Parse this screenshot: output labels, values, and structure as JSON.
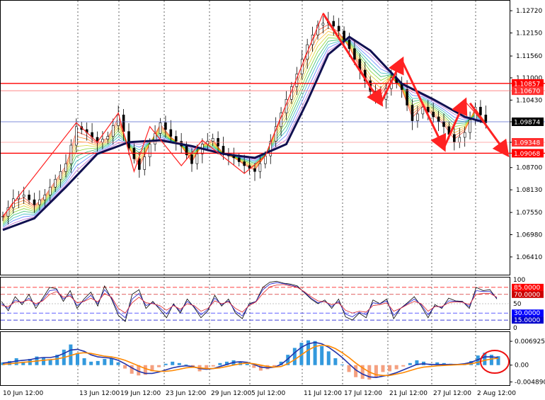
{
  "chart_data": [
    {
      "type": "candlestick",
      "panel": "price",
      "title": "",
      "ylim": [
        1.061,
        1.1285
      ],
      "y_ticks": [
        "1.12720",
        "1.12150",
        "1.11560",
        "1.11000",
        "1.10430",
        "1.09874",
        "1.09348",
        "1.08700",
        "1.08130",
        "1.07550",
        "1.06980",
        "1.06410"
      ],
      "x_ticks": [
        "10 Jun 12:00",
        "13 Jun 12:00",
        "19 Jun 12:00",
        "23 Jun 12:00",
        "29 Jun 12:00",
        "5 Jul 12:00",
        "11 Jul 12:00",
        "17 Jul 12:00",
        "21 Jul 12:00",
        "27 Jul 12:00",
        "2 Aug 12:00"
      ],
      "close_path": [
        {
          "i": 0,
          "v": 1.0745
        },
        {
          "i": 2,
          "v": 1.079
        },
        {
          "i": 4,
          "v": 1.08
        },
        {
          "i": 6,
          "v": 1.0775
        },
        {
          "i": 8,
          "v": 1.08
        },
        {
          "i": 10,
          "v": 1.084
        },
        {
          "i": 12,
          "v": 1.088
        },
        {
          "i": 14,
          "v": 1.0975
        },
        {
          "i": 16,
          "v": 1.096
        },
        {
          "i": 18,
          "v": 1.0935
        },
        {
          "i": 20,
          "v": 1.095
        },
        {
          "i": 22,
          "v": 1.1005
        },
        {
          "i": 24,
          "v": 1.092
        },
        {
          "i": 26,
          "v": 1.0865
        },
        {
          "i": 28,
          "v": 1.093
        },
        {
          "i": 30,
          "v": 1.0985
        },
        {
          "i": 32,
          "v": 1.095
        },
        {
          "i": 34,
          "v": 1.0925
        },
        {
          "i": 36,
          "v": 1.088
        },
        {
          "i": 38,
          "v": 1.093
        },
        {
          "i": 40,
          "v": 1.0945
        },
        {
          "i": 42,
          "v": 1.0905
        },
        {
          "i": 44,
          "v": 1.0895
        },
        {
          "i": 46,
          "v": 1.0875
        },
        {
          "i": 48,
          "v": 1.086
        },
        {
          "i": 50,
          "v": 1.09
        },
        {
          "i": 52,
          "v": 1.0975
        },
        {
          "i": 54,
          "v": 1.1045
        },
        {
          "i": 56,
          "v": 1.111
        },
        {
          "i": 58,
          "v": 1.1185
        },
        {
          "i": 60,
          "v": 1.1235
        },
        {
          "i": 62,
          "v": 1.1245
        },
        {
          "i": 64,
          "v": 1.122
        },
        {
          "i": 66,
          "v": 1.1175
        },
        {
          "i": 68,
          "v": 1.112
        },
        {
          "i": 70,
          "v": 1.1065
        },
        {
          "i": 72,
          "v": 1.1045
        },
        {
          "i": 74,
          "v": 1.11
        },
        {
          "i": 76,
          "v": 1.107
        },
        {
          "i": 78,
          "v": 1.099
        },
        {
          "i": 80,
          "v": 1.1025
        },
        {
          "i": 82,
          "v": 1.1
        },
        {
          "i": 84,
          "v": 1.0975
        },
        {
          "i": 86,
          "v": 1.0935
        },
        {
          "i": 88,
          "v": 1.096
        },
        {
          "i": 90,
          "v": 1.1025
        },
        {
          "i": 92,
          "v": 1.0985
        }
      ],
      "moving_average": [
        {
          "i": 0,
          "v": 1.071
        },
        {
          "i": 6,
          "v": 1.074
        },
        {
          "i": 12,
          "v": 1.082
        },
        {
          "i": 18,
          "v": 1.0905
        },
        {
          "i": 24,
          "v": 1.0935
        },
        {
          "i": 30,
          "v": 1.094
        },
        {
          "i": 36,
          "v": 1.0925
        },
        {
          "i": 42,
          "v": 1.0905
        },
        {
          "i": 48,
          "v": 1.0895
        },
        {
          "i": 54,
          "v": 1.093
        },
        {
          "i": 58,
          "v": 1.104
        },
        {
          "i": 62,
          "v": 1.116
        },
        {
          "i": 66,
          "v": 1.1205
        },
        {
          "i": 70,
          "v": 1.117
        },
        {
          "i": 76,
          "v": 1.1085
        },
        {
          "i": 82,
          "v": 1.1045
        },
        {
          "i": 88,
          "v": 1.1
        },
        {
          "i": 92,
          "v": 1.0985
        }
      ],
      "zigzag": [
        {
          "i": 0,
          "v": 1.0745
        },
        {
          "i": 14,
          "v": 1.0985
        },
        {
          "i": 18,
          "v": 1.0935
        },
        {
          "i": 22,
          "v": 1.101
        },
        {
          "i": 25,
          "v": 1.086
        },
        {
          "i": 28,
          "v": 1.0975
        },
        {
          "i": 34,
          "v": 1.0875
        },
        {
          "i": 38,
          "v": 1.094
        },
        {
          "i": 46,
          "v": 1.0855
        },
        {
          "i": 50,
          "v": 1.09
        },
        {
          "i": 61,
          "v": 1.1265
        },
        {
          "i": 72,
          "v": 1.1035
        },
        {
          "i": 76,
          "v": 1.1145
        },
        {
          "i": 84,
          "v": 1.092
        },
        {
          "i": 88,
          "v": 1.104
        },
        {
          "i": 92,
          "v": 1.098
        }
      ],
      "arrows": [
        {
          "from": {
            "i": 61,
            "v": 1.1265
          },
          "to": {
            "i": 72,
            "v": 1.1035
          }
        },
        {
          "from": {
            "i": 72,
            "v": 1.1035
          },
          "to": {
            "i": 76,
            "v": 1.1145
          }
        },
        {
          "from": {
            "i": 76,
            "v": 1.1145
          },
          "to": {
            "i": 84,
            "v": 1.092
          }
        },
        {
          "from": {
            "i": 84,
            "v": 1.092
          },
          "to": {
            "i": 88,
            "v": 1.104
          }
        },
        {
          "from": {
            "i": 89,
            "v": 1.1035
          },
          "to": {
            "i": 96,
            "v": 1.0905
          }
        }
      ],
      "levels": [
        {
          "label": "1.10857",
          "value": 1.10857,
          "color": "#ff0000",
          "tag_color": "#ff0000",
          "width": 1.4
        },
        {
          "label": "1.10670",
          "value": 1.1067,
          "color": "#ff6060",
          "tag_color": "#ff3030",
          "width": 0.8
        },
        {
          "label": "1.09874",
          "value": 1.09874,
          "color": "#5566cc",
          "tag_color": "#000000",
          "width": 0.8
        },
        {
          "label": "1.09348",
          "value": 1.09348,
          "color": "#ff9090",
          "tag_color": "#ff3030",
          "width": 0.8
        },
        {
          "label": "1.09068",
          "value": 1.09068,
          "color": "#ff0000",
          "tag_color": "#ff0000",
          "width": 1.4
        }
      ]
    },
    {
      "type": "line",
      "panel": "oscillator",
      "ylim": [
        0,
        100
      ],
      "y_ticks": [
        "100",
        "50",
        "0"
      ],
      "levels": [
        {
          "label": "85.0000",
          "value": 85,
          "color": "#ff0000"
        },
        {
          "label": "70.0000",
          "value": 70,
          "color": "#cc0000"
        },
        {
          "label": "30.0000",
          "value": 30,
          "color": "#0000ff"
        },
        {
          "label": "15.0000",
          "value": 15,
          "color": "#0000cc"
        }
      ],
      "series": [
        {
          "color": "#000000",
          "values": [
            55,
            35,
            65,
            48,
            70,
            40,
            62,
            85,
            82,
            55,
            78,
            40,
            60,
            75,
            45,
            88,
            60,
            25,
            12,
            70,
            80,
            40,
            55,
            38,
            20,
            50,
            30,
            60,
            42,
            20,
            35,
            68,
            45,
            60,
            30,
            18,
            50,
            55,
            85,
            96,
            98,
            94,
            92,
            88,
            74,
            60,
            50,
            58,
            40,
            60,
            22,
            15,
            30,
            20,
            58,
            50,
            60,
            18,
            40,
            52,
            65,
            45,
            20,
            48,
            40,
            62,
            56,
            55,
            40,
            85,
            78,
            80,
            60
          ]
        },
        {
          "color": "#2222cc",
          "values": [
            50,
            40,
            58,
            52,
            62,
            46,
            58,
            78,
            80,
            60,
            70,
            46,
            56,
            68,
            50,
            80,
            62,
            32,
            20,
            60,
            72,
            46,
            52,
            42,
            28,
            48,
            34,
            55,
            44,
            26,
            38,
            62,
            48,
            56,
            34,
            24,
            48,
            55,
            80,
            92,
            95,
            93,
            90,
            86,
            75,
            62,
            52,
            55,
            44,
            55,
            28,
            22,
            32,
            26,
            52,
            50,
            56,
            25,
            40,
            50,
            60,
            48,
            26,
            45,
            42,
            56,
            55,
            54,
            44,
            78,
            76,
            76,
            62
          ]
        },
        {
          "color": "#dd2222",
          "values": [
            46,
            44,
            54,
            54,
            58,
            50,
            56,
            70,
            76,
            64,
            66,
            52,
            55,
            62,
            54,
            72,
            64,
            40,
            30,
            52,
            64,
            52,
            50,
            46,
            36,
            46,
            38,
            50,
            46,
            34,
            40,
            56,
            50,
            54,
            40,
            32,
            46,
            54,
            72,
            86,
            90,
            91,
            88,
            85,
            76,
            65,
            56,
            54,
            48,
            52,
            36,
            30,
            34,
            32,
            46,
            48,
            52,
            34,
            40,
            48,
            55,
            50,
            34,
            44,
            44,
            52,
            54,
            53,
            48,
            70,
            72,
            72,
            64
          ]
        }
      ]
    },
    {
      "type": "bar",
      "panel": "macd",
      "y_ticks": [
        "0.0069255",
        "0.00",
        "-0.0048908"
      ],
      "ylim": [
        -0.0052,
        0.009
      ],
      "histogram": [
        0.0008,
        0.0012,
        0.002,
        0.001,
        0.0018,
        0.0025,
        0.0022,
        0.0015,
        0.003,
        0.0045,
        0.006,
        0.0035,
        0.002,
        0.001,
        0.0012,
        0.0018,
        0.002,
        0.0008,
        -0.001,
        -0.0025,
        -0.003,
        -0.0028,
        -0.0018,
        -0.0006,
        0.0004,
        0.001,
        0.0006,
        0.0002,
        -0.0008,
        -0.0018,
        -0.0012,
        -0.0004,
        0.0006,
        0.001,
        0.0014,
        0.001,
        0.0004,
        -0.0008,
        -0.0016,
        -0.0012,
        -0.0006,
        0.001,
        0.003,
        0.005,
        0.0065,
        0.0072,
        0.007,
        0.0055,
        0.004,
        0.002,
        0.0002,
        -0.002,
        -0.0035,
        -0.004,
        -0.0042,
        -0.0035,
        -0.002,
        -0.0018,
        -0.0012,
        -0.0004,
        0.0006,
        0.0014,
        0.001,
        0.0004,
        0.0008,
        0.0006,
        0.0004,
        0.0002,
        0.0004,
        0.0012,
        0.0028,
        0.0036,
        0.003,
        0.0026
      ],
      "series": [
        {
          "color": "#2233aa",
          "values": [
            0.0006,
            0.0008,
            0.0012,
            0.0014,
            0.0016,
            0.002,
            0.0022,
            0.0022,
            0.0026,
            0.0034,
            0.0044,
            0.0046,
            0.004,
            0.003,
            0.0024,
            0.0022,
            0.002,
            0.0014,
            0.0004,
            -0.0008,
            -0.0018,
            -0.0024,
            -0.0024,
            -0.002,
            -0.0014,
            -0.0008,
            -0.0004,
            -0.0002,
            -0.0004,
            -0.001,
            -0.0012,
            -0.001,
            -0.0004,
            0.0002,
            0.0008,
            0.001,
            0.0008,
            0.0002,
            -0.0006,
            -0.0008,
            -0.0006,
            0.0002,
            0.0018,
            0.0036,
            0.0052,
            0.0062,
            0.0066,
            0.0062,
            0.0052,
            0.0038,
            0.0022,
            0.0004,
            -0.0014,
            -0.0026,
            -0.0034,
            -0.0036,
            -0.0032,
            -0.0028,
            -0.0022,
            -0.0014,
            -0.0006,
            0.0002,
            0.0004,
            0.0002,
            0.0002,
            0.0002,
            0.0002,
            0.0002,
            0.0004,
            0.0008,
            0.0016,
            0.0024,
            0.0024,
            0.0022
          ]
        },
        {
          "color": "#ff8800",
          "values": [
            0.0002,
            0.0004,
            0.0006,
            0.0008,
            0.001,
            0.0012,
            0.0014,
            0.0016,
            0.0018,
            0.0022,
            0.0028,
            0.0034,
            0.0036,
            0.0034,
            0.003,
            0.0026,
            0.0024,
            0.002,
            0.0014,
            0.0006,
            -0.0002,
            -0.001,
            -0.0016,
            -0.0018,
            -0.0018,
            -0.0016,
            -0.0012,
            -0.0008,
            -0.0006,
            -0.0008,
            -0.001,
            -0.001,
            -0.0008,
            -0.0004,
            0.0,
            0.0004,
            0.0006,
            0.0004,
            0.0,
            -0.0004,
            -0.0006,
            -0.0004,
            0.0004,
            0.0016,
            0.003,
            0.0044,
            0.0054,
            0.0058,
            0.0056,
            0.0048,
            0.0036,
            0.0022,
            0.0006,
            -0.0008,
            -0.002,
            -0.0028,
            -0.003,
            -0.003,
            -0.0026,
            -0.0022,
            -0.0016,
            -0.001,
            -0.0006,
            -0.0004,
            -0.0002,
            -0.0001,
            0.0,
            0.0001,
            0.0002,
            0.0004,
            0.0008,
            0.0014,
            0.0018,
            0.002
          ]
        }
      ],
      "annotation": "red circle around latest histogram bars"
    }
  ]
}
